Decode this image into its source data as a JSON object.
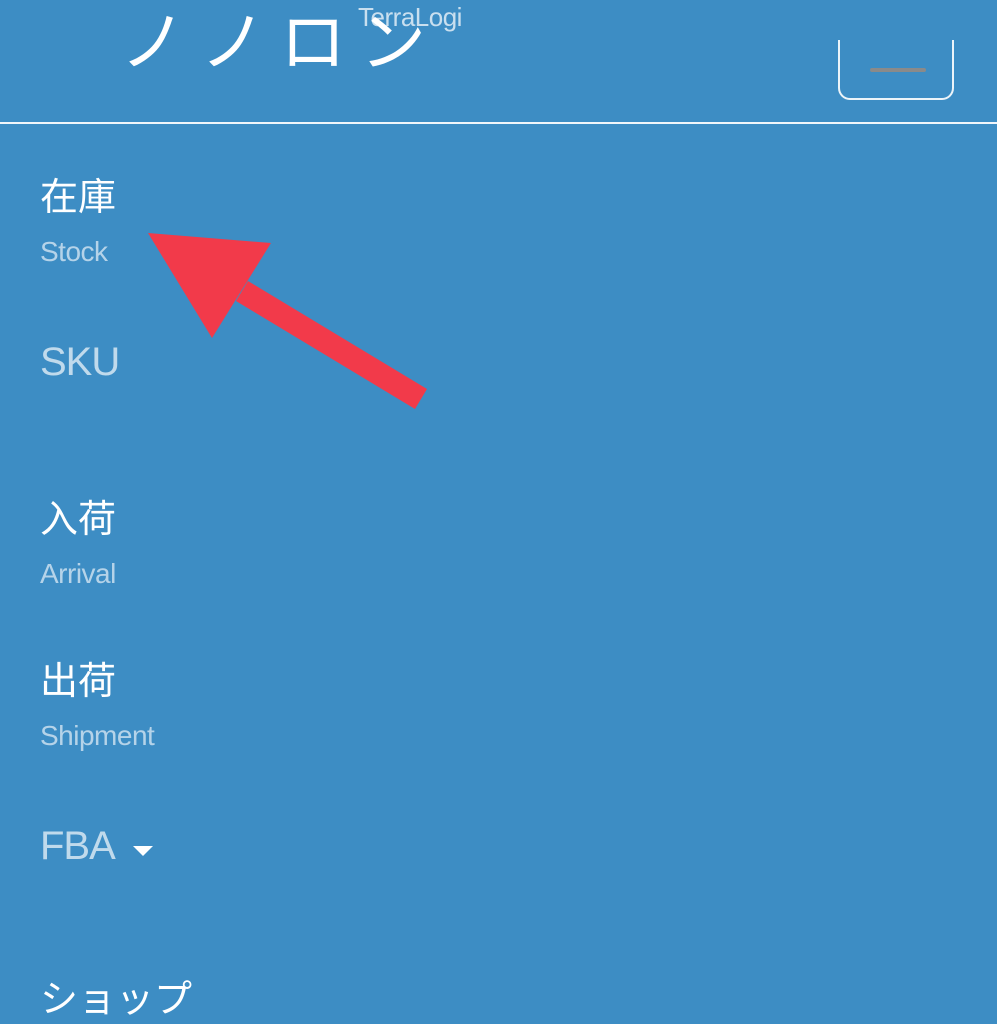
{
  "header": {
    "app_title": "TerraLogi",
    "logo_text": "ノノロン"
  },
  "nav": {
    "stock": {
      "label_jp": "在庫",
      "label_en": "Stock"
    },
    "sku": {
      "label": "SKU"
    },
    "arrival": {
      "label_jp": "入荷",
      "label_en": "Arrival"
    },
    "shipment": {
      "label_jp": "出荷",
      "label_en": "Shipment"
    },
    "fba": {
      "label": "FBA"
    },
    "shop": {
      "label_jp": "ショップ"
    }
  },
  "colors": {
    "background": "#3d8dc4",
    "annotation_arrow": "#f23a4a"
  },
  "icons": {
    "menu_toggle": "hamburger-icon",
    "fba_caret": "caret-down-icon",
    "annotation": "arrow-annotation"
  }
}
